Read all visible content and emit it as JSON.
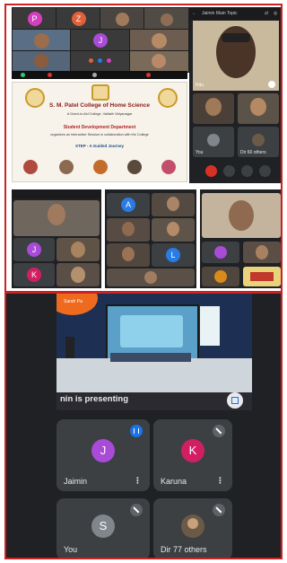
{
  "zoom_grid": {
    "avatars": [
      {
        "letter": "P",
        "color": "#d33fbf"
      },
      {
        "letter": "Z",
        "color": "#e0603a"
      },
      {
        "letter": "J",
        "color": "#a94bd6"
      }
    ]
  },
  "poster": {
    "college": "S. M. Patel College of Home Science",
    "sub_lines": "A Grant-in-Aid College, Vallabh Vidyanagar",
    "department": "Student Development Department",
    "event_lines": "organizes an Interactive Session in collaboration with the College",
    "event_name": "STEP - A Guided Journey"
  },
  "meet_panel": {
    "header": "Jaimin Main Topic",
    "self_label": "Ritu",
    "you_label": "You",
    "others_label": "Dir  60 others"
  },
  "mid_panels": {
    "left_avatars": [
      {
        "letter": "J",
        "color": "#a94bd6"
      },
      {
        "letter": "K",
        "color": "#d21f64"
      }
    ],
    "center_avatars": [
      {
        "letter": "A",
        "color": "#2a7be4"
      },
      {
        "letter": "L",
        "color": "#2a7be4"
      }
    ]
  },
  "bottom": {
    "banner": "Sarah Pa",
    "presenting_caption": "nin is presenting",
    "participants": [
      {
        "letter": "J",
        "name": "Jaimin",
        "color": "#a94bd6",
        "badge": "speaking"
      },
      {
        "letter": "K",
        "name": "Karuna",
        "color": "#d21f64",
        "badge": "muted"
      },
      {
        "letter": "S",
        "name": "You",
        "color": "#80868b",
        "badge": "muted"
      },
      {
        "letter": "",
        "name": "Dir  77 others",
        "color": "#6b5a48",
        "badge": "muted"
      }
    ],
    "more_icon": "⋮"
  },
  "colors": {
    "frame_border": "#cc2222",
    "meet_bg": "#202124",
    "tile_bg": "#3c4043",
    "speaking_blue": "#1a73e8"
  }
}
